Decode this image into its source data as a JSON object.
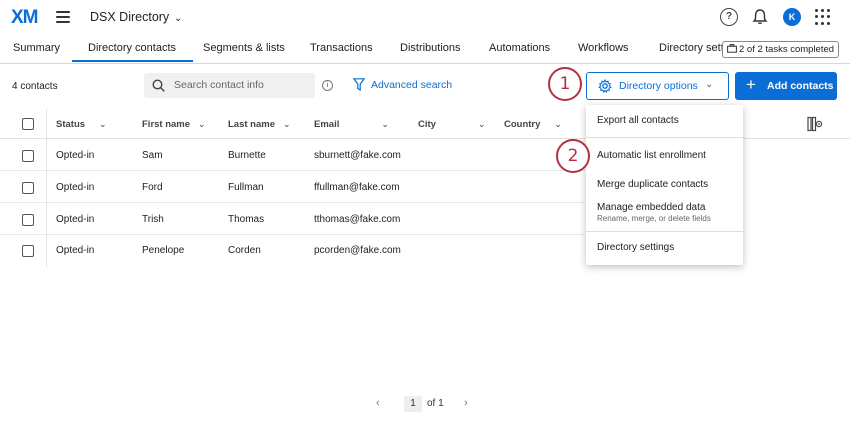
{
  "header": {
    "logo": "XM",
    "project": "DSX Directory",
    "avatar_initial": "K",
    "help_glyph": "?"
  },
  "tabs": [
    {
      "label": "Summary"
    },
    {
      "label": "Directory contacts"
    },
    {
      "label": "Segments & lists"
    },
    {
      "label": "Transactions"
    },
    {
      "label": "Distributions"
    },
    {
      "label": "Automations"
    },
    {
      "label": "Workflows"
    },
    {
      "label": "Directory setti"
    }
  ],
  "tasks_badge": "2 of 2 tasks completed",
  "toolbar": {
    "count": "4 contacts",
    "search_placeholder": "Search contact info",
    "advanced_search": "Advanced search",
    "directory_options": "Directory options",
    "add_contacts": "Add contacts"
  },
  "callouts": [
    "1",
    "2"
  ],
  "table": {
    "headers": [
      "Status",
      "First name",
      "Last name",
      "Email",
      "City",
      "Country"
    ],
    "rows": [
      [
        "Opted-in",
        "Sam",
        "Burnette",
        "sburnett@fake.com"
      ],
      [
        "Opted-in",
        "Ford",
        "Fullman",
        "ffullman@fake.com"
      ],
      [
        "Opted-in",
        "Trish",
        "Thomas",
        "tthomas@fake.com"
      ],
      [
        "Opted-in",
        "Penelope",
        "Corden",
        "pcorden@fake.com"
      ]
    ]
  },
  "menu": {
    "export": "Export all contacts",
    "auto_list": "Automatic list enrollment",
    "merge": "Merge duplicate contacts",
    "embedded": "Manage embedded data",
    "embedded_sub": "Rename, merge, or delete fields",
    "settings": "Directory settings"
  },
  "pager": {
    "current": "1",
    "of": "of 1"
  },
  "colors": {
    "accent": "#0b6ed7",
    "callout": "#b5303e"
  }
}
